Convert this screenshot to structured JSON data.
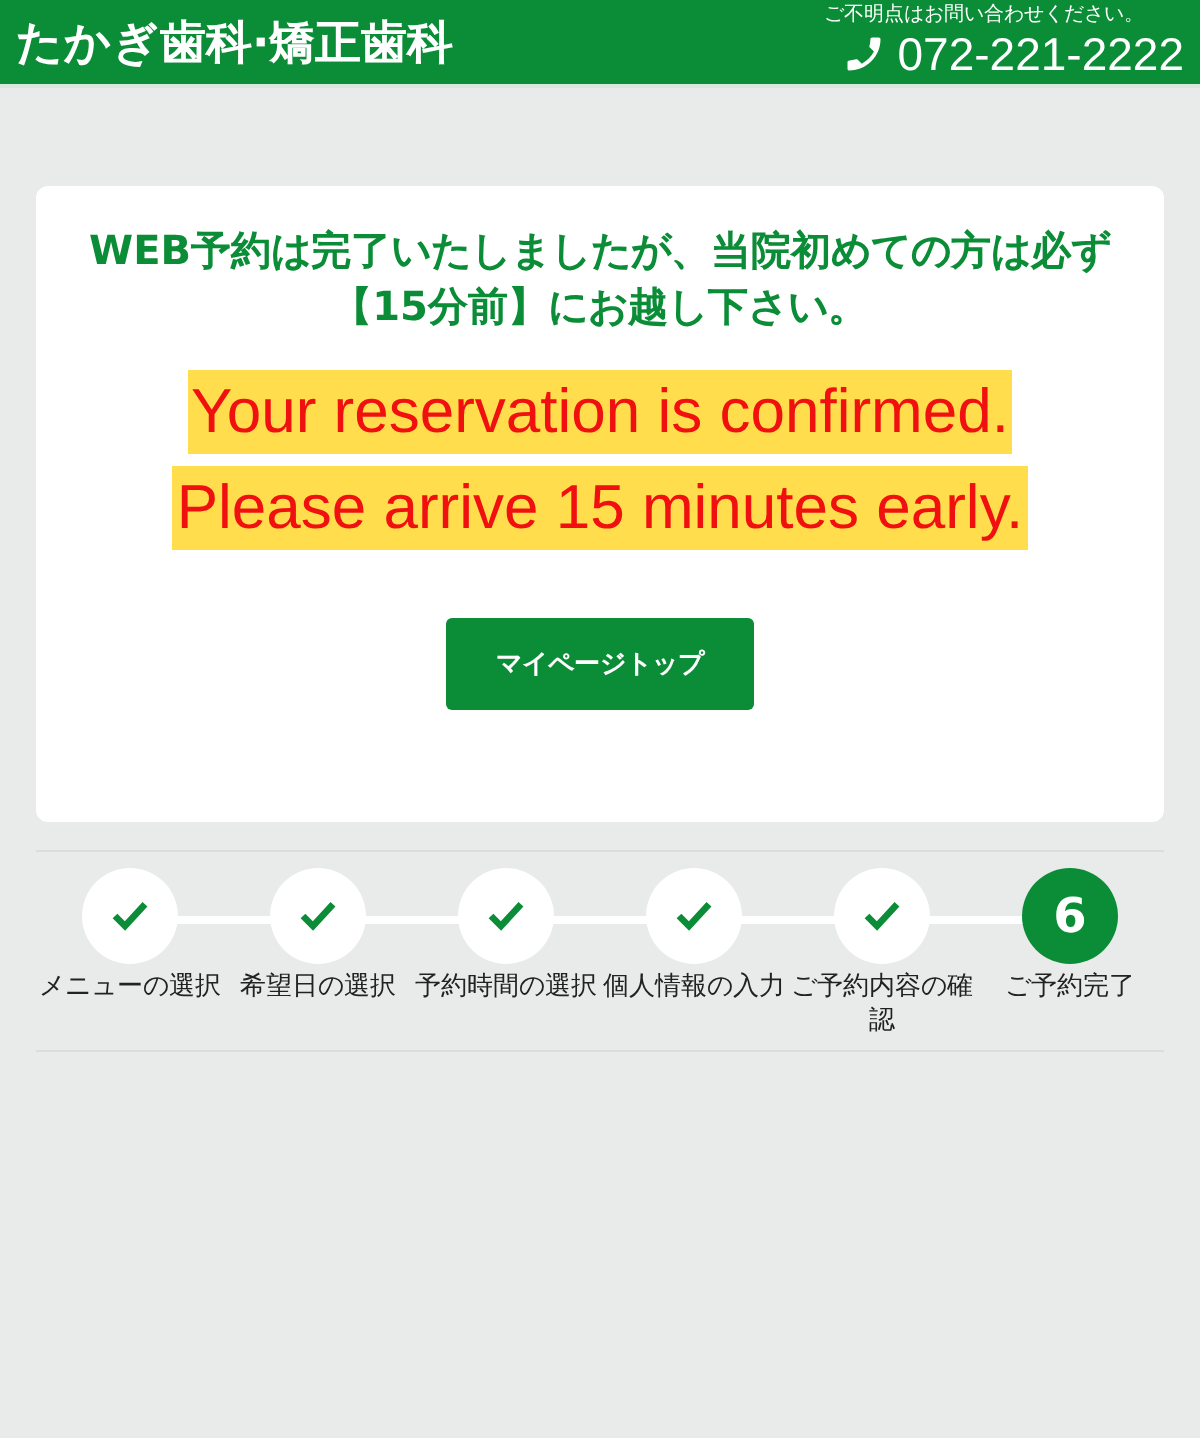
{
  "header": {
    "clinic_name": "たかぎ歯科·矯正歯科",
    "contact_note": "ご不明点はお問い合わせください。",
    "phone": "072-221-2222"
  },
  "notice": {
    "heading": "WEB予約は完了いたしましたが、当院初めての方は必ず【15分前】にお越し下さい。",
    "highlight_lines": [
      "Your reservation is confirmed.",
      "Please arrive 15 minutes early."
    ],
    "button": "マイページトップ"
  },
  "steps": [
    {
      "label": "メニューの選択",
      "done": true
    },
    {
      "label": "希望日の選択",
      "done": true
    },
    {
      "label": "予約時間の選択",
      "done": true
    },
    {
      "label": "個人情報の入力",
      "done": true
    },
    {
      "label": "ご予約内容の確認",
      "done": true
    },
    {
      "label": "ご予約完了",
      "done": false,
      "number": "6"
    }
  ]
}
